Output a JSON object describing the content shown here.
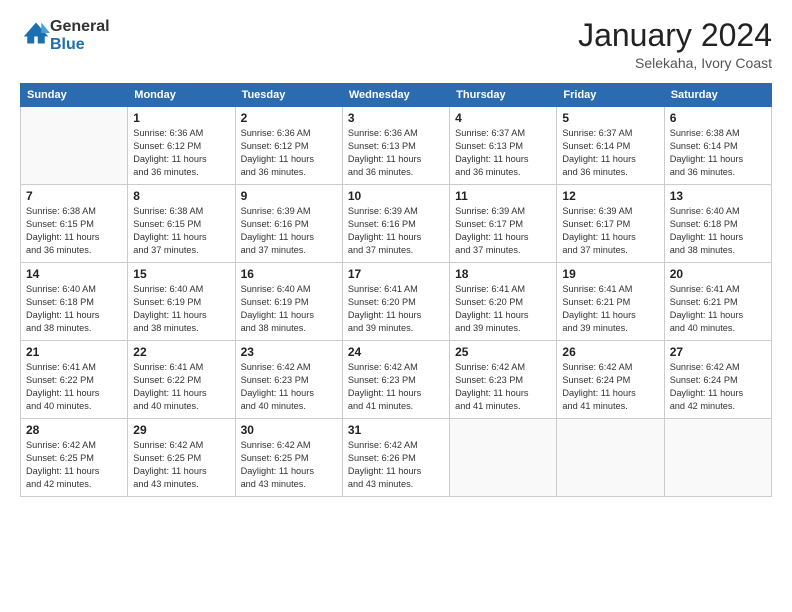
{
  "logo": {
    "general": "General",
    "blue": "Blue"
  },
  "header": {
    "month_year": "January 2024",
    "location": "Selekaha, Ivory Coast"
  },
  "days_of_week": [
    "Sunday",
    "Monday",
    "Tuesday",
    "Wednesday",
    "Thursday",
    "Friday",
    "Saturday"
  ],
  "weeks": [
    [
      {
        "day": "",
        "info": ""
      },
      {
        "day": "1",
        "info": "Sunrise: 6:36 AM\nSunset: 6:12 PM\nDaylight: 11 hours\nand 36 minutes."
      },
      {
        "day": "2",
        "info": "Sunrise: 6:36 AM\nSunset: 6:12 PM\nDaylight: 11 hours\nand 36 minutes."
      },
      {
        "day": "3",
        "info": "Sunrise: 6:36 AM\nSunset: 6:13 PM\nDaylight: 11 hours\nand 36 minutes."
      },
      {
        "day": "4",
        "info": "Sunrise: 6:37 AM\nSunset: 6:13 PM\nDaylight: 11 hours\nand 36 minutes."
      },
      {
        "day": "5",
        "info": "Sunrise: 6:37 AM\nSunset: 6:14 PM\nDaylight: 11 hours\nand 36 minutes."
      },
      {
        "day": "6",
        "info": "Sunrise: 6:38 AM\nSunset: 6:14 PM\nDaylight: 11 hours\nand 36 minutes."
      }
    ],
    [
      {
        "day": "7",
        "info": "Sunrise: 6:38 AM\nSunset: 6:15 PM\nDaylight: 11 hours\nand 36 minutes."
      },
      {
        "day": "8",
        "info": "Sunrise: 6:38 AM\nSunset: 6:15 PM\nDaylight: 11 hours\nand 37 minutes."
      },
      {
        "day": "9",
        "info": "Sunrise: 6:39 AM\nSunset: 6:16 PM\nDaylight: 11 hours\nand 37 minutes."
      },
      {
        "day": "10",
        "info": "Sunrise: 6:39 AM\nSunset: 6:16 PM\nDaylight: 11 hours\nand 37 minutes."
      },
      {
        "day": "11",
        "info": "Sunrise: 6:39 AM\nSunset: 6:17 PM\nDaylight: 11 hours\nand 37 minutes."
      },
      {
        "day": "12",
        "info": "Sunrise: 6:39 AM\nSunset: 6:17 PM\nDaylight: 11 hours\nand 37 minutes."
      },
      {
        "day": "13",
        "info": "Sunrise: 6:40 AM\nSunset: 6:18 PM\nDaylight: 11 hours\nand 38 minutes."
      }
    ],
    [
      {
        "day": "14",
        "info": "Sunrise: 6:40 AM\nSunset: 6:18 PM\nDaylight: 11 hours\nand 38 minutes."
      },
      {
        "day": "15",
        "info": "Sunrise: 6:40 AM\nSunset: 6:19 PM\nDaylight: 11 hours\nand 38 minutes."
      },
      {
        "day": "16",
        "info": "Sunrise: 6:40 AM\nSunset: 6:19 PM\nDaylight: 11 hours\nand 38 minutes."
      },
      {
        "day": "17",
        "info": "Sunrise: 6:41 AM\nSunset: 6:20 PM\nDaylight: 11 hours\nand 39 minutes."
      },
      {
        "day": "18",
        "info": "Sunrise: 6:41 AM\nSunset: 6:20 PM\nDaylight: 11 hours\nand 39 minutes."
      },
      {
        "day": "19",
        "info": "Sunrise: 6:41 AM\nSunset: 6:21 PM\nDaylight: 11 hours\nand 39 minutes."
      },
      {
        "day": "20",
        "info": "Sunrise: 6:41 AM\nSunset: 6:21 PM\nDaylight: 11 hours\nand 40 minutes."
      }
    ],
    [
      {
        "day": "21",
        "info": "Sunrise: 6:41 AM\nSunset: 6:22 PM\nDaylight: 11 hours\nand 40 minutes."
      },
      {
        "day": "22",
        "info": "Sunrise: 6:41 AM\nSunset: 6:22 PM\nDaylight: 11 hours\nand 40 minutes."
      },
      {
        "day": "23",
        "info": "Sunrise: 6:42 AM\nSunset: 6:23 PM\nDaylight: 11 hours\nand 40 minutes."
      },
      {
        "day": "24",
        "info": "Sunrise: 6:42 AM\nSunset: 6:23 PM\nDaylight: 11 hours\nand 41 minutes."
      },
      {
        "day": "25",
        "info": "Sunrise: 6:42 AM\nSunset: 6:23 PM\nDaylight: 11 hours\nand 41 minutes."
      },
      {
        "day": "26",
        "info": "Sunrise: 6:42 AM\nSunset: 6:24 PM\nDaylight: 11 hours\nand 41 minutes."
      },
      {
        "day": "27",
        "info": "Sunrise: 6:42 AM\nSunset: 6:24 PM\nDaylight: 11 hours\nand 42 minutes."
      }
    ],
    [
      {
        "day": "28",
        "info": "Sunrise: 6:42 AM\nSunset: 6:25 PM\nDaylight: 11 hours\nand 42 minutes."
      },
      {
        "day": "29",
        "info": "Sunrise: 6:42 AM\nSunset: 6:25 PM\nDaylight: 11 hours\nand 43 minutes."
      },
      {
        "day": "30",
        "info": "Sunrise: 6:42 AM\nSunset: 6:25 PM\nDaylight: 11 hours\nand 43 minutes."
      },
      {
        "day": "31",
        "info": "Sunrise: 6:42 AM\nSunset: 6:26 PM\nDaylight: 11 hours\nand 43 minutes."
      },
      {
        "day": "",
        "info": ""
      },
      {
        "day": "",
        "info": ""
      },
      {
        "day": "",
        "info": ""
      }
    ]
  ]
}
